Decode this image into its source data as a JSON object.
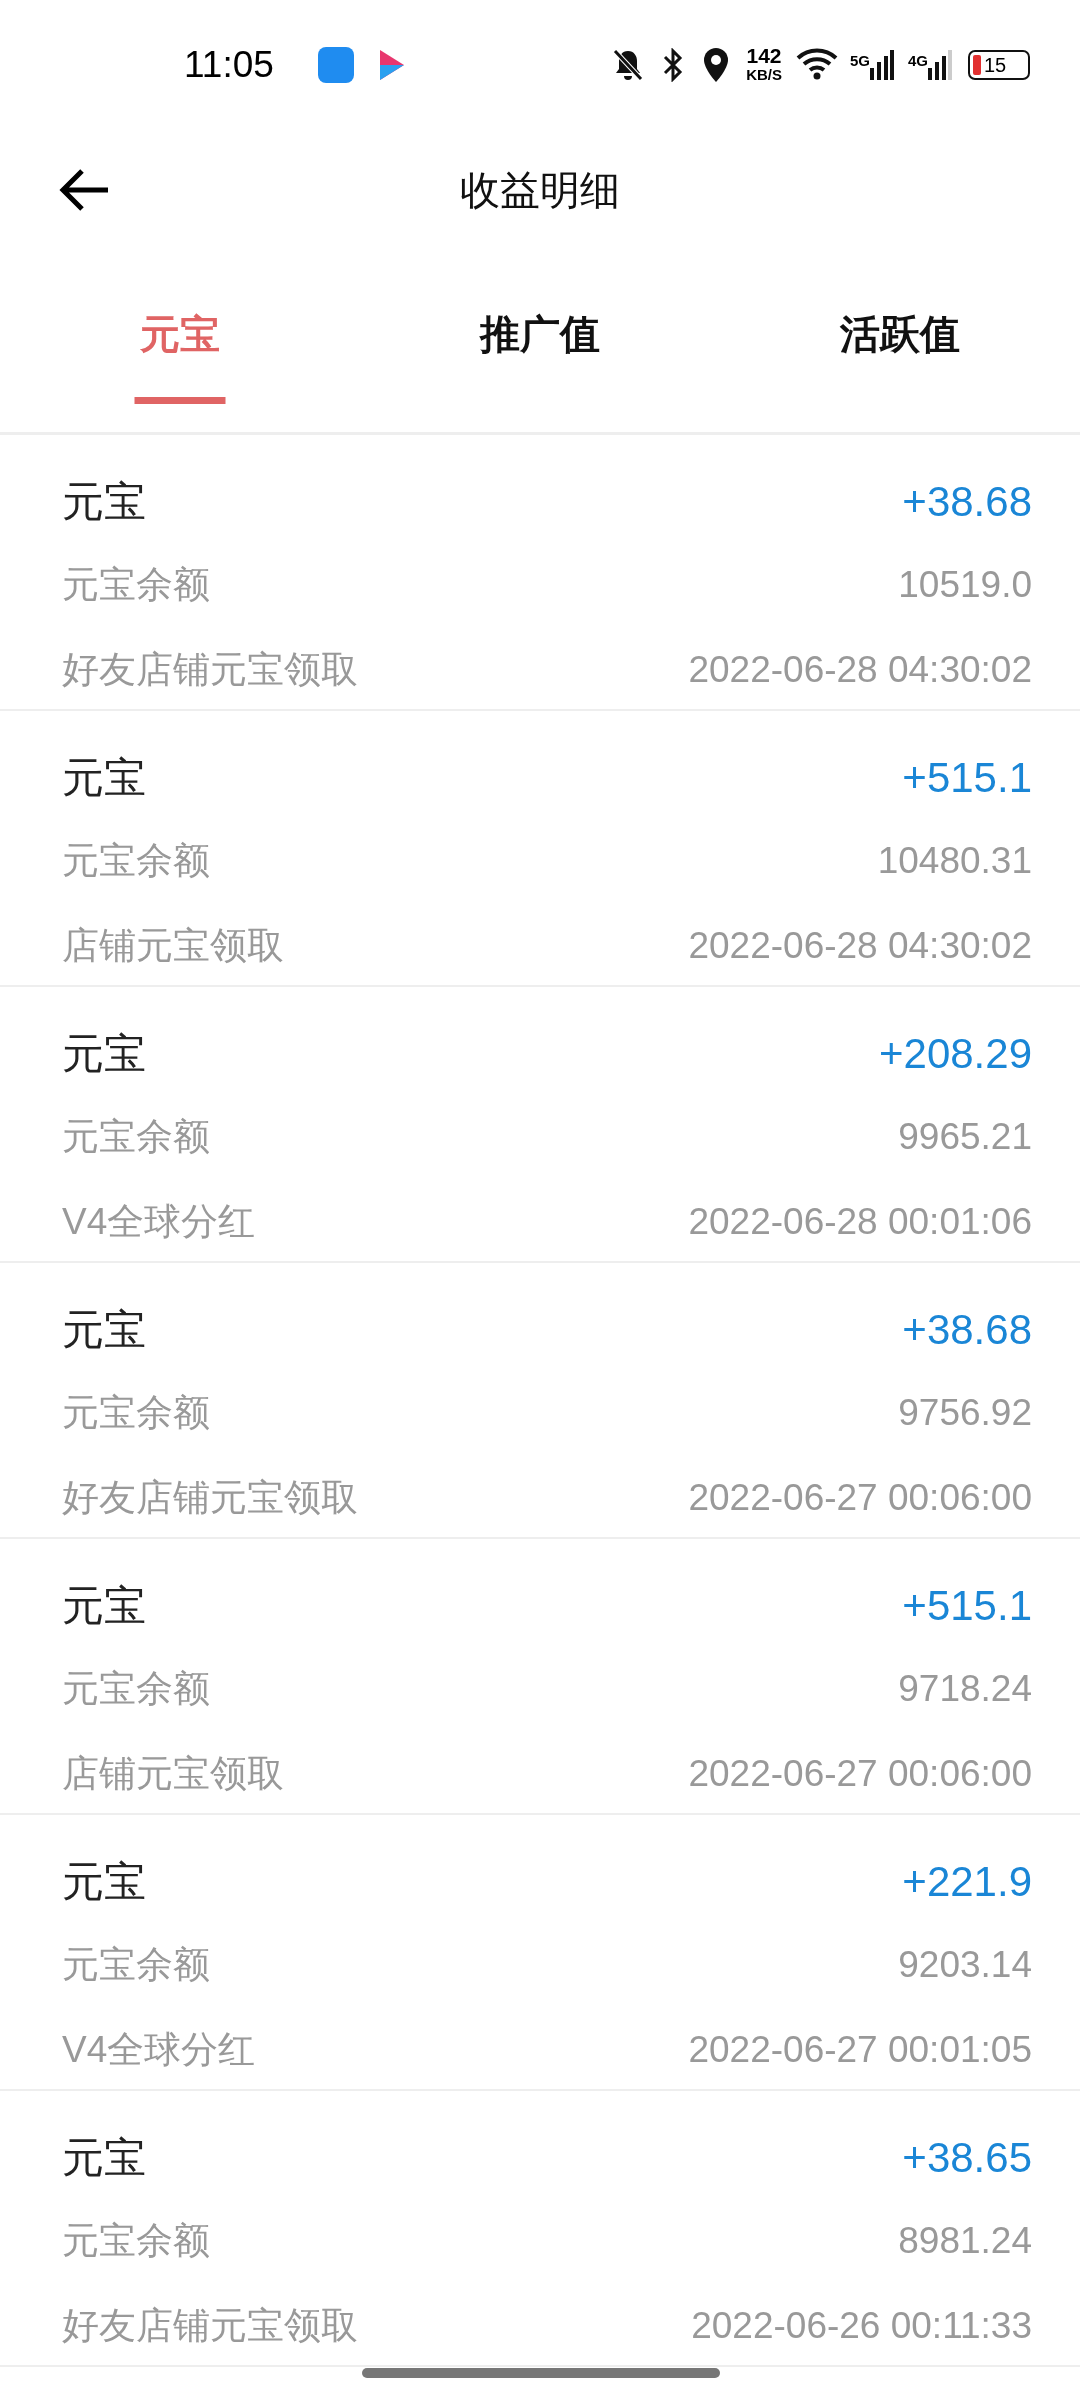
{
  "status_bar": {
    "time": "11:05",
    "net_speed": "142",
    "net_unit": "KB/S",
    "signal_1": "5G",
    "signal_2": "4G",
    "battery": "15"
  },
  "header": {
    "title": "收益明细"
  },
  "tabs": [
    {
      "label": "元宝",
      "selected": true
    },
    {
      "label": "推广值",
      "selected": false
    },
    {
      "label": "活跃值",
      "selected": false
    }
  ],
  "records": [
    {
      "title": "元宝",
      "amount": "+38.68",
      "balance_label": "元宝余额",
      "balance": "10519.0",
      "source": "好友店铺元宝领取",
      "time": "2022-06-28 04:30:02"
    },
    {
      "title": "元宝",
      "amount": "+515.1",
      "balance_label": "元宝余额",
      "balance": "10480.31",
      "source": "店铺元宝领取",
      "time": "2022-06-28 04:30:02"
    },
    {
      "title": "元宝",
      "amount": "+208.29",
      "balance_label": "元宝余额",
      "balance": "9965.21",
      "source": "V4全球分红",
      "time": "2022-06-28 00:01:06"
    },
    {
      "title": "元宝",
      "amount": "+38.68",
      "balance_label": "元宝余额",
      "balance": "9756.92",
      "source": "好友店铺元宝领取",
      "time": "2022-06-27 00:06:00"
    },
    {
      "title": "元宝",
      "amount": "+515.1",
      "balance_label": "元宝余额",
      "balance": "9718.24",
      "source": "店铺元宝领取",
      "time": "2022-06-27 00:06:00"
    },
    {
      "title": "元宝",
      "amount": "+221.9",
      "balance_label": "元宝余额",
      "balance": "9203.14",
      "source": "V4全球分红",
      "time": "2022-06-27 00:01:05"
    },
    {
      "title": "元宝",
      "amount": "+38.65",
      "balance_label": "元宝余额",
      "balance": "8981.24",
      "source": "好友店铺元宝领取",
      "time": "2022-06-26 00:11:33"
    }
  ]
}
